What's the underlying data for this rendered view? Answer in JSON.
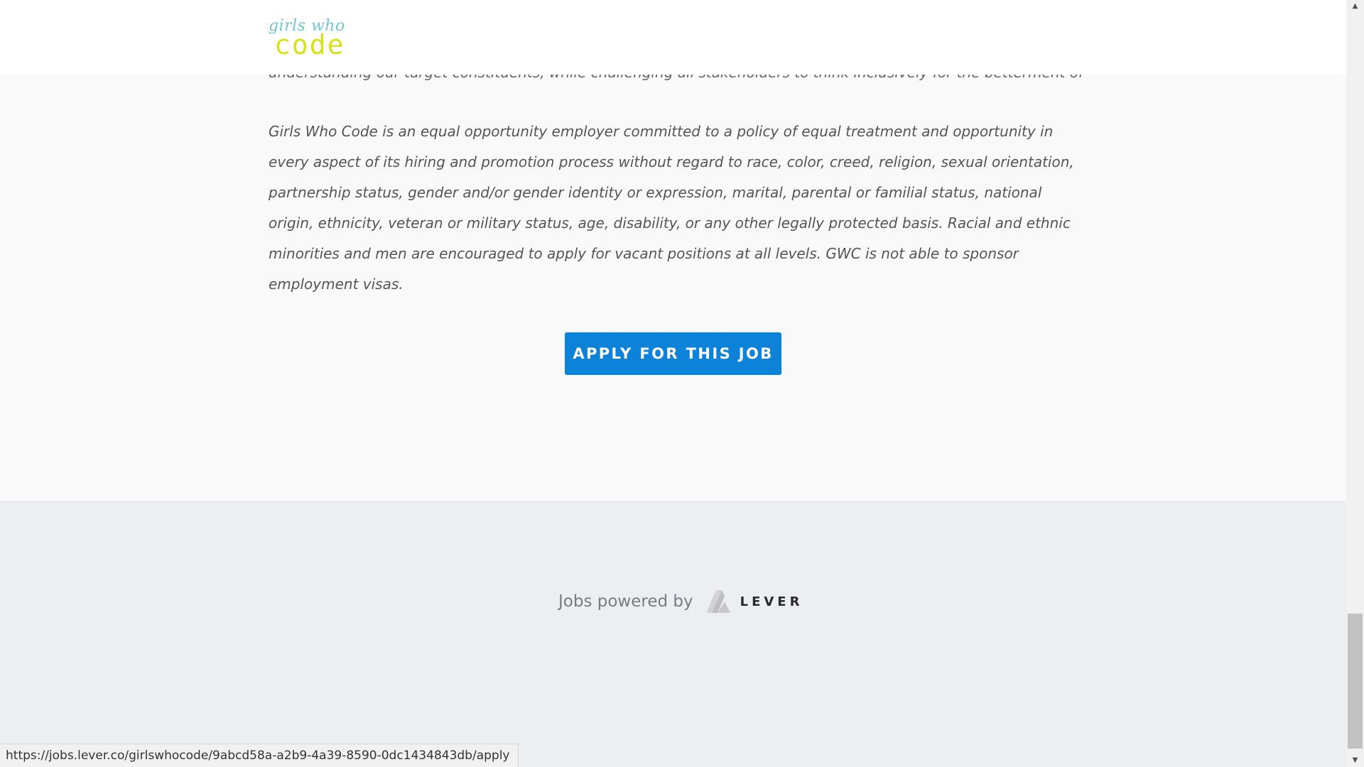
{
  "header": {
    "logo": {
      "top": "girls who",
      "bottom": "code",
      "colors": {
        "top": "#6fc7cf",
        "bottom": "#d8e21a"
      }
    }
  },
  "content": {
    "cut_line": "understanding our target constituents, while challenging all stakeholders to think inclusively for the betterment of our programs.",
    "eeo_statement": "Girls Who Code is an equal opportunity employer committed to a policy of equal treatment and opportunity in every aspect of its hiring and promotion process without regard to race, color, creed, religion, sexual orientation, partnership status, gender and/or gender identity or expression, marital, parental or familial status, national origin, ethnicity, veteran or military status, age, disability, or any other legally protected basis. Racial and ethnic minorities and men are encouraged to apply for vacant positions at all levels. GWC is not able to sponsor employment visas.",
    "apply_button": "APPLY FOR THIS JOB"
  },
  "footer": {
    "powered_by": "Jobs powered by",
    "brand": "LEVER"
  },
  "status_bar": {
    "url": "https://jobs.lever.co/girlswhocode/9abcd58a-a2b9-4a39-8590-0dc1434843db/apply"
  },
  "scrollbar": {
    "up_icon": "▲",
    "down_icon": "▼"
  },
  "colors": {
    "accent": "#0c83d9",
    "page_bg": "#f9f9f9",
    "footer_bg": "#edeef1"
  }
}
